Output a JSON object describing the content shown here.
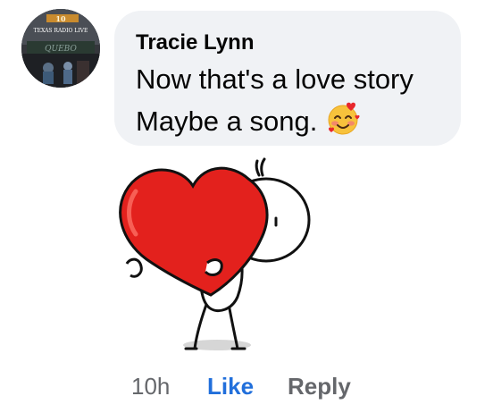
{
  "comment": {
    "author": "Tracie Lynn",
    "lines": [
      "Now that's a love story",
      "Maybe a song."
    ],
    "emoji": "smiling-face-with-hearts-icon",
    "sticker": "stick-figure-hugging-heart"
  },
  "avatar": {
    "text": "TEXAS RADIO LIVE"
  },
  "actions": {
    "time": "10h",
    "like": "Like",
    "reply": "Reply"
  },
  "colors": {
    "bubble": "#f0f2f5",
    "like": "#216fdb",
    "meta": "#65676b",
    "heart": "#e3211d"
  }
}
